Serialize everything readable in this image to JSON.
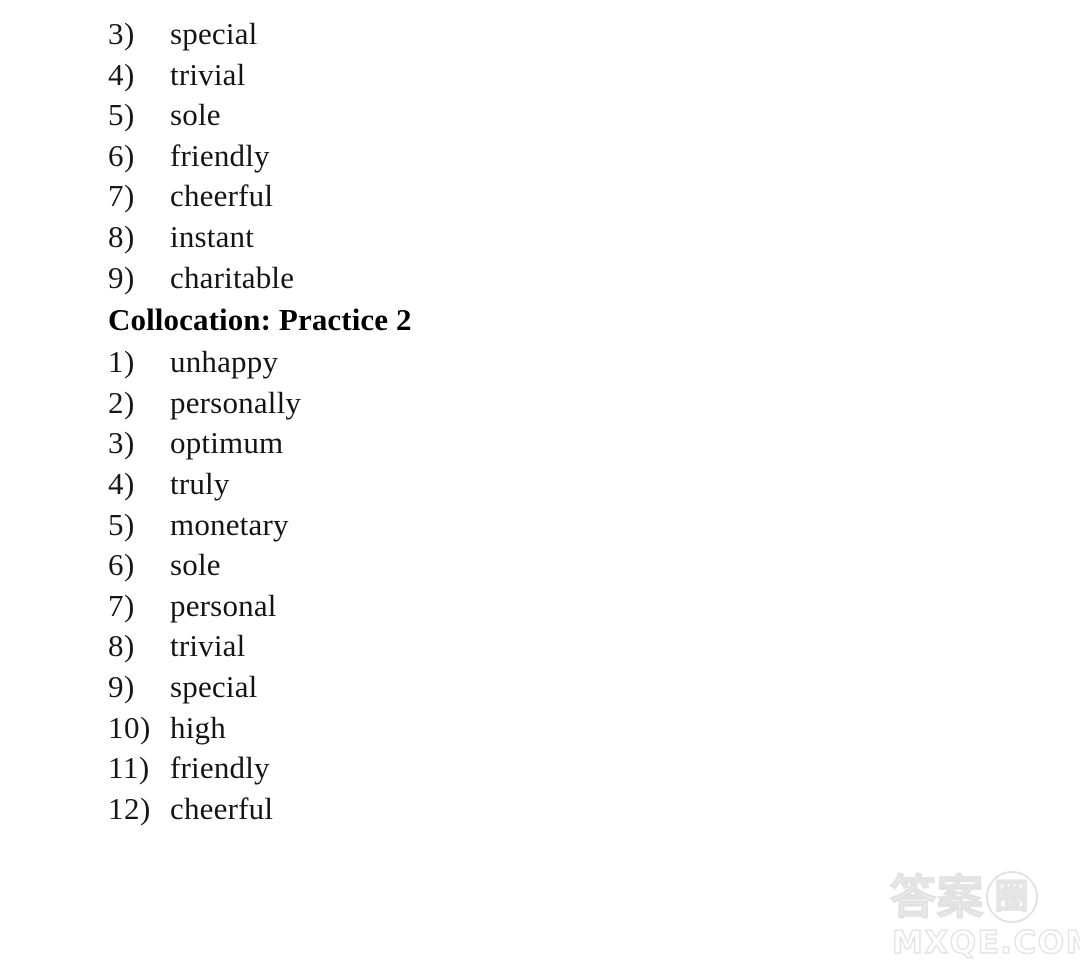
{
  "document": {
    "type": "answer-key-page",
    "background_color": "#ffffff",
    "text_color": "#1a1a1a"
  },
  "lists": [
    {
      "id": "list-continued",
      "heading": null,
      "items": [
        {
          "number": "3)",
          "word": "special"
        },
        {
          "number": "4)",
          "word": "trivial"
        },
        {
          "number": "5)",
          "word": "sole"
        },
        {
          "number": "6)",
          "word": "friendly"
        },
        {
          "number": "7)",
          "word": "cheerful"
        },
        {
          "number": "8)",
          "word": "instant"
        },
        {
          "number": "9)",
          "word": "charitable"
        }
      ]
    },
    {
      "id": "list-collocation-practice-2",
      "heading": "Collocation: Practice 2",
      "items": [
        {
          "number": "1)",
          "word": "unhappy"
        },
        {
          "number": "2)",
          "word": "personally"
        },
        {
          "number": "3)",
          "word": "optimum"
        },
        {
          "number": "4)",
          "word": "truly"
        },
        {
          "number": "5)",
          "word": "monetary"
        },
        {
          "number": "6)",
          "word": "sole"
        },
        {
          "number": "7)",
          "word": "personal"
        },
        {
          "number": "8)",
          "word": "trivial"
        },
        {
          "number": "9)",
          "word": "special"
        },
        {
          "number": "10)",
          "word": "high"
        },
        {
          "number": "11)",
          "word": "friendly"
        },
        {
          "number": "12)",
          "word": "cheerful"
        }
      ]
    }
  ],
  "watermark": {
    "cjk_prefix": "答案",
    "cjk_circled": "圈",
    "domain": "MXQE.COM",
    "color": "#e3e3e3"
  }
}
